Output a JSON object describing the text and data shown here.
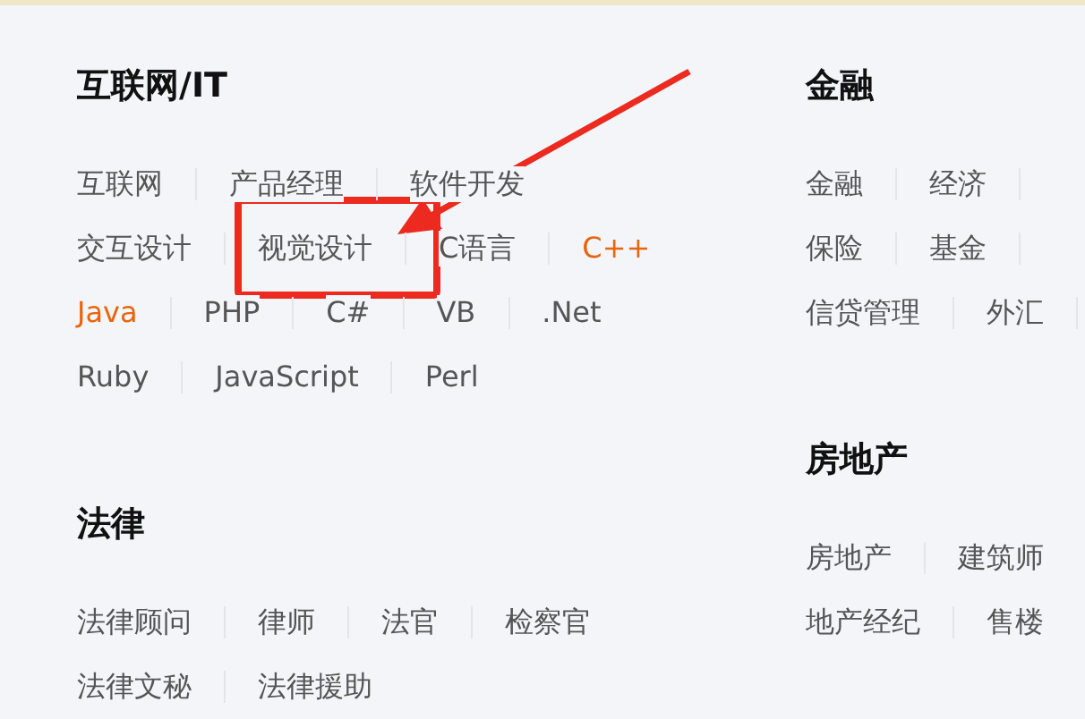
{
  "columns": [
    {
      "sections": [
        {
          "title": "互联网/IT",
          "lines": [
            {
              "links": [
                {
                  "text": "互联网",
                  "hot": false
                },
                {
                  "text": "产品经理",
                  "hot": false
                },
                {
                  "text": "软件开发",
                  "hot": false
                }
              ]
            },
            {
              "links": [
                {
                  "text": "交互设计",
                  "hot": false
                },
                {
                  "text": "视觉设计",
                  "hot": false
                },
                {
                  "text": "C语言",
                  "hot": false
                },
                {
                  "text": "C++",
                  "hot": true
                }
              ]
            },
            {
              "links": [
                {
                  "text": "Java",
                  "hot": true
                },
                {
                  "text": "PHP",
                  "hot": false
                },
                {
                  "text": "C#",
                  "hot": false
                },
                {
                  "text": "VB",
                  "hot": false
                },
                {
                  "text": ".Net",
                  "hot": false
                }
              ]
            },
            {
              "links": [
                {
                  "text": "Ruby",
                  "hot": false
                },
                {
                  "text": "JavaScript",
                  "hot": false
                },
                {
                  "text": "Perl",
                  "hot": false
                }
              ]
            }
          ]
        },
        {
          "title": "法律",
          "lines": [
            {
              "links": [
                {
                  "text": "法律顾问",
                  "hot": false
                },
                {
                  "text": "律师",
                  "hot": false
                },
                {
                  "text": "法官",
                  "hot": false
                },
                {
                  "text": "检察官",
                  "hot": false
                }
              ]
            },
            {
              "links": [
                {
                  "text": "法律文秘",
                  "hot": false
                },
                {
                  "text": "法律援助",
                  "hot": false
                }
              ]
            }
          ]
        }
      ]
    },
    {
      "sections": [
        {
          "title": "金融",
          "lines": [
            {
              "links": [
                {
                  "text": "金融",
                  "hot": false
                },
                {
                  "text": "经济",
                  "hot": false
                }
              ]
            },
            {
              "links": [
                {
                  "text": "保险",
                  "hot": false
                },
                {
                  "text": "基金",
                  "hot": false
                }
              ]
            },
            {
              "links": [
                {
                  "text": "信贷管理",
                  "hot": false
                },
                {
                  "text": "外汇",
                  "hot": false
                }
              ]
            }
          ]
        },
        {
          "title": "房地产",
          "lines": [
            {
              "links": [
                {
                  "text": "房地产",
                  "hot": false
                },
                {
                  "text": "建筑师",
                  "hot": false
                }
              ]
            },
            {
              "links": [
                {
                  "text": "地产经纪",
                  "hot": false
                },
                {
                  "text": "售楼",
                  "hot": false
                }
              ]
            }
          ]
        }
      ]
    }
  ]
}
